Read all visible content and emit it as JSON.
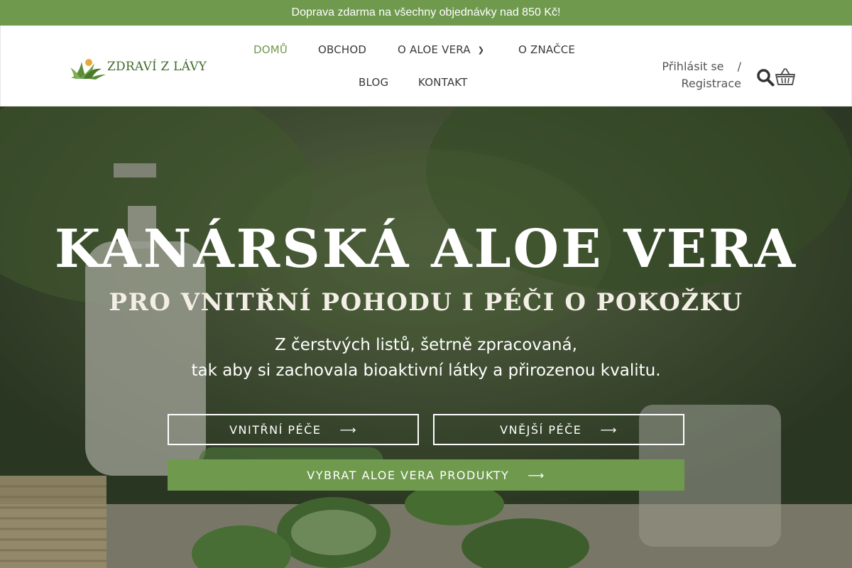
{
  "topbar": {
    "text": "Doprava zdarma na všechny objednávky nad 850 Kč!"
  },
  "logo": {
    "text": "ZDRAVÍ Z LÁVY"
  },
  "nav": {
    "items": [
      "DOMŮ",
      "OBCHOD",
      "O ALOE VERA",
      "O ZNAČCE",
      "BLOG",
      "KONTAKT"
    ],
    "active": "DOMŮ"
  },
  "account": {
    "login": "Přihlásit se",
    "separator": "/",
    "register": "Registrace"
  },
  "hero": {
    "title": "KANÁRSKÁ ALOE VERA",
    "subtitle": "PRO VNITŘNÍ POHODU I PÉČI O POKOŽKU",
    "line1": "Z čerstvých listů, šetrně zpracovaná,",
    "line2": "tak aby si zachovala bioaktivní látky a přirozenou kvalitu."
  },
  "buttons": {
    "internal": "VNITŘNÍ PÉČE",
    "external": "VNĚJŠÍ PÉČE",
    "products": "VYBRAT ALOE VERA PRODUKTY"
  },
  "colors": {
    "accent": "#6f9a4d",
    "text": "#3a3a3a"
  },
  "icons": [
    "search-icon",
    "basket-icon",
    "chevron-down-icon",
    "arrow-right-icon"
  ]
}
